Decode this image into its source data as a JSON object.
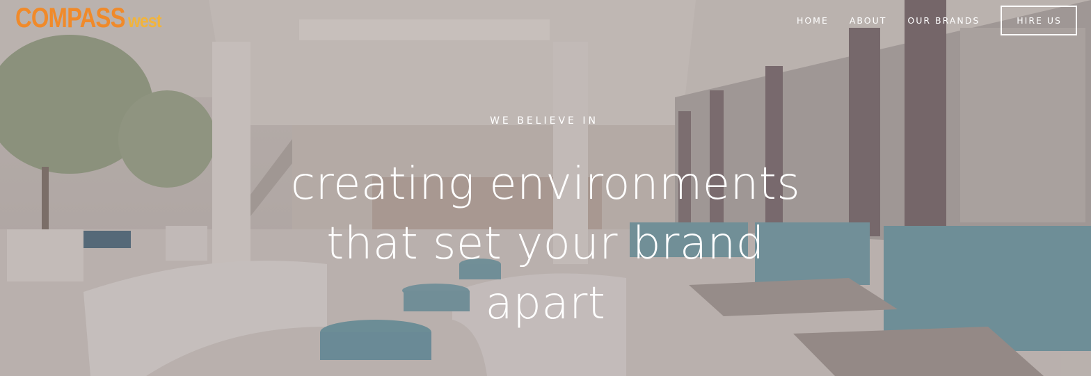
{
  "brand": {
    "name_main": "COMPASS",
    "name_sub": "west"
  },
  "nav": {
    "items": [
      {
        "label": "HOME"
      },
      {
        "label": "ABOUT"
      },
      {
        "label": "OUR BRANDS"
      }
    ],
    "cta_label": "HIRE US"
  },
  "hero": {
    "eyebrow": "WE BELIEVE IN",
    "headline": "creating environments that set your brand apart"
  },
  "colors": {
    "logo_orange": "#f08a2a",
    "logo_yellow": "#f2b43a",
    "text": "#ffffff"
  }
}
